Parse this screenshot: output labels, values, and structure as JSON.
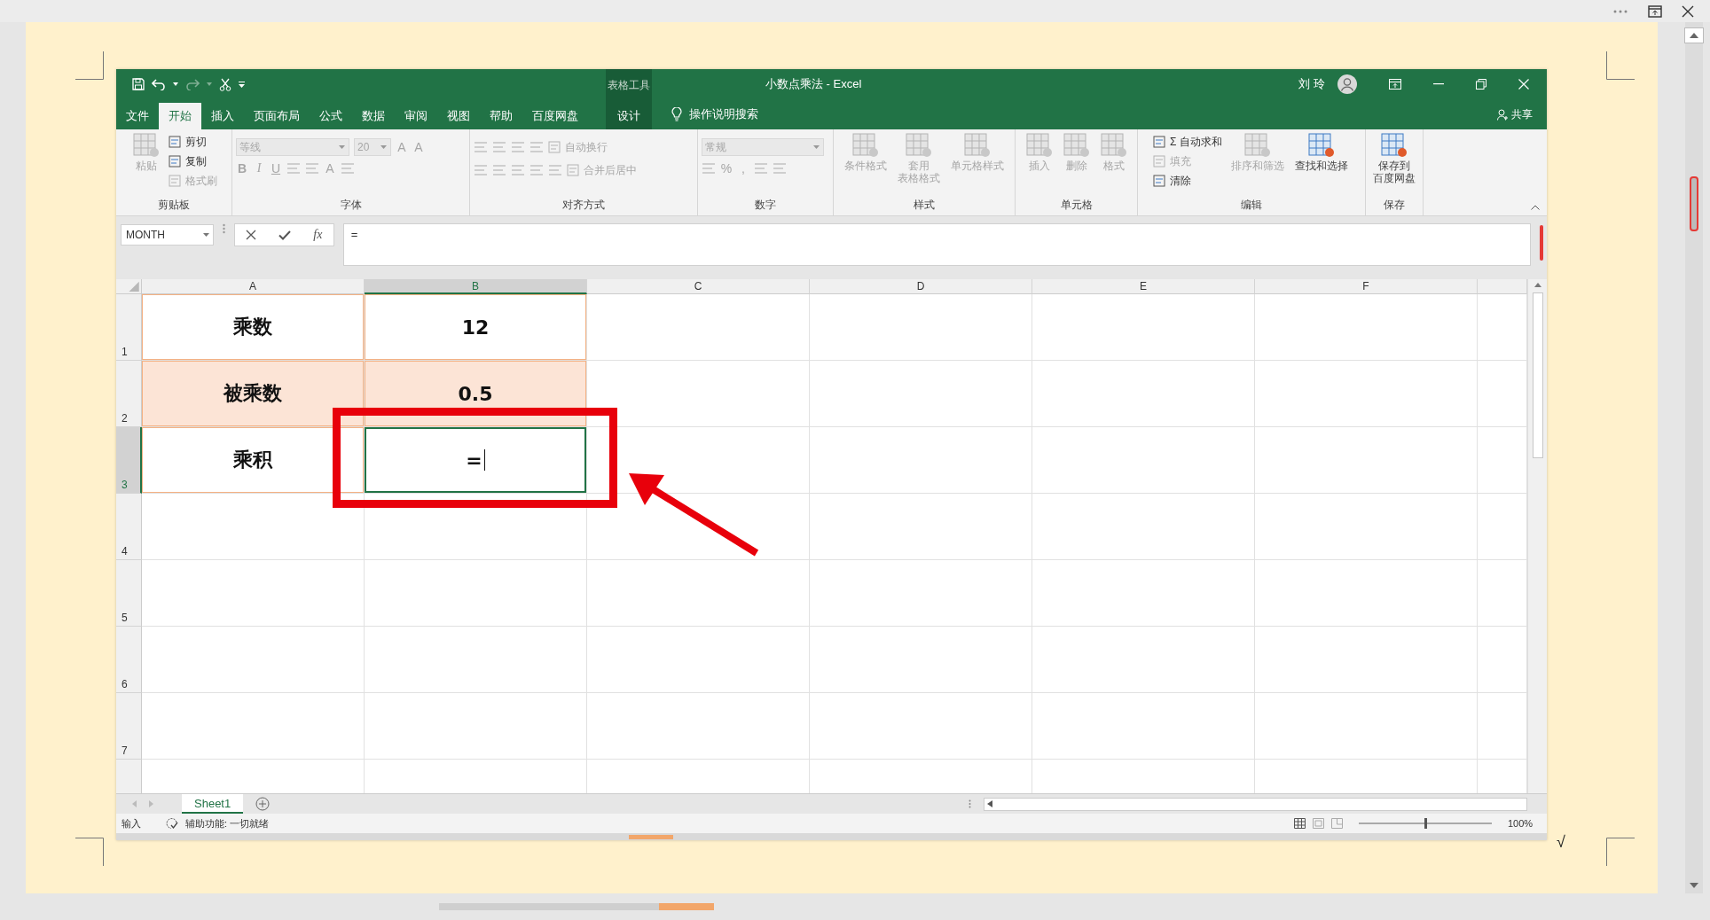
{
  "viewer": {
    "page_mark": "√"
  },
  "excel": {
    "context_label": "表格工具",
    "title": "小数点乘法 - Excel",
    "user": "刘 玲",
    "tabs": [
      {
        "label": "文件",
        "selected": false
      },
      {
        "label": "开始",
        "selected": true
      },
      {
        "label": "插入",
        "selected": false
      },
      {
        "label": "页面布局",
        "selected": false
      },
      {
        "label": "公式",
        "selected": false
      },
      {
        "label": "数据",
        "selected": false
      },
      {
        "label": "审阅",
        "selected": false
      },
      {
        "label": "视图",
        "selected": false
      },
      {
        "label": "帮助",
        "selected": false
      },
      {
        "label": "百度网盘",
        "selected": false
      }
    ],
    "context_tab": {
      "label": "设计",
      "selected": false
    },
    "tell_me": "操作说明搜索",
    "share": "共享",
    "ribbon": [
      {
        "title": "剪贴板",
        "kind": "columns",
        "parts": [
          [
            {
              "kind": "large",
              "label": "粘贴",
              "disabled": true
            }
          ],
          [
            {
              "kind": "small",
              "label": "剪切",
              "disabled": false
            },
            {
              "kind": "small",
              "label": "复制",
              "disabled": false
            },
            {
              "kind": "small",
              "label": "格式刷",
              "disabled": true
            }
          ]
        ]
      },
      {
        "title": "字体",
        "kind": "rows",
        "parts": [
          [
            {
              "kind": "dropdown",
              "label": "等线",
              "disabled": true
            },
            {
              "kind": "dropdown",
              "label": "20",
              "disabled": true
            },
            {
              "kind": "glyph",
              "label": "A",
              "disabled": true
            },
            {
              "kind": "glyph",
              "label": "A",
              "disabled": true
            }
          ],
          [
            {
              "kind": "bold",
              "label": "B",
              "disabled": true
            },
            {
              "kind": "italic",
              "label": "I",
              "disabled": true
            },
            {
              "kind": "underline",
              "label": "U",
              "disabled": true
            },
            {
              "kind": "icon",
              "disabled": true
            },
            {
              "kind": "icon",
              "disabled": true
            },
            {
              "kind": "glyph",
              "label": "A",
              "disabled": true
            },
            {
              "kind": "icon",
              "disabled": true
            }
          ]
        ]
      },
      {
        "title": "对齐方式",
        "kind": "rows",
        "parts": [
          [
            {
              "kind": "icon",
              "disabled": true
            },
            {
              "kind": "icon",
              "disabled": true
            },
            {
              "kind": "icon",
              "disabled": true
            },
            {
              "kind": "icon",
              "disabled": true
            },
            {
              "kind": "small",
              "label": "自动换行",
              "disabled": true
            }
          ],
          [
            {
              "kind": "icon",
              "disabled": true
            },
            {
              "kind": "icon",
              "disabled": true
            },
            {
              "kind": "icon",
              "disabled": true
            },
            {
              "kind": "icon",
              "disabled": true
            },
            {
              "kind": "icon",
              "disabled": true
            },
            {
              "kind": "small",
              "label": "合并后居中",
              "disabled": true
            }
          ]
        ]
      },
      {
        "title": "数字",
        "kind": "rows",
        "parts": [
          [
            {
              "kind": "dropdown",
              "label": "常规",
              "disabled": true
            }
          ],
          [
            {
              "kind": "icon",
              "disabled": true
            },
            {
              "kind": "glyph",
              "label": "%",
              "disabled": true
            },
            {
              "kind": "glyph",
              "label": ",",
              "disabled": true
            },
            {
              "kind": "icon",
              "disabled": true
            },
            {
              "kind": "icon",
              "disabled": true
            }
          ]
        ]
      },
      {
        "title": "样式",
        "kind": "columns",
        "parts": [
          [
            {
              "kind": "large",
              "label": "条件格式",
              "disabled": true
            }
          ],
          [
            {
              "kind": "large",
              "lines": [
                "套用",
                "表格格式"
              ],
              "disabled": true
            }
          ],
          [
            {
              "kind": "large",
              "label": "单元格样式",
              "disabled": true
            }
          ]
        ]
      },
      {
        "title": "单元格",
        "kind": "columns",
        "parts": [
          [
            {
              "kind": "large",
              "label": "插入",
              "disabled": true
            }
          ],
          [
            {
              "kind": "large",
              "label": "删除",
              "disabled": true
            }
          ],
          [
            {
              "kind": "large",
              "label": "格式",
              "disabled": true
            }
          ]
        ]
      },
      {
        "title": "编辑",
        "kind": "columns",
        "parts": [
          [
            {
              "kind": "small",
              "label": "Σ 自动求和",
              "disabled": false
            },
            {
              "kind": "small",
              "label": "填充",
              "disabled": true
            },
            {
              "kind": "small",
              "label": "清除",
              "disabled": false
            }
          ],
          [
            {
              "kind": "large",
              "label": "排序和筛选",
              "disabled": true
            }
          ],
          [
            {
              "kind": "large",
              "label": "查找和选择",
              "disabled": false
            }
          ]
        ]
      },
      {
        "title": "保存",
        "kind": "columns",
        "parts": [
          [
            {
              "kind": "large",
              "lines": [
                "保存到",
                "百度网盘"
              ],
              "disabled": false
            }
          ]
        ]
      }
    ],
    "name_box": "MONTH",
    "function_button": "fx",
    "formula": "=",
    "columns": [
      {
        "label": "A",
        "selected": false
      },
      {
        "label": "B",
        "selected": true
      },
      {
        "label": "C",
        "selected": false
      },
      {
        "label": "D",
        "selected": false
      },
      {
        "label": "E",
        "selected": false
      },
      {
        "label": "F",
        "selected": false
      }
    ],
    "rows": [
      {
        "label": "1",
        "selected": false,
        "cells": [
          {
            "text": "乘数",
            "shaded": false,
            "editing": false
          },
          {
            "text": "12",
            "shaded": false,
            "editing": false
          }
        ]
      },
      {
        "label": "2",
        "selected": false,
        "cells": [
          {
            "text": "被乘数",
            "shaded": true,
            "editing": false
          },
          {
            "text": "0.5",
            "shaded": true,
            "editing": false
          }
        ]
      },
      {
        "label": "3",
        "selected": true,
        "cells": [
          {
            "text": "乘积",
            "shaded": false,
            "editing": false
          },
          {
            "text": "=",
            "shaded": false,
            "editing": true
          }
        ]
      },
      {
        "label": "4",
        "selected": false
      },
      {
        "label": "5",
        "selected": false
      },
      {
        "label": "6",
        "selected": false
      },
      {
        "label": "7",
        "selected": false
      }
    ],
    "sheets": [
      {
        "label": "Sheet1",
        "selected": true
      }
    ],
    "status": {
      "mode": "输入",
      "accessibility": "辅助功能: 一切就绪",
      "zoom": "100%",
      "zoom_slider": {
        "level": 0.5
      }
    }
  }
}
